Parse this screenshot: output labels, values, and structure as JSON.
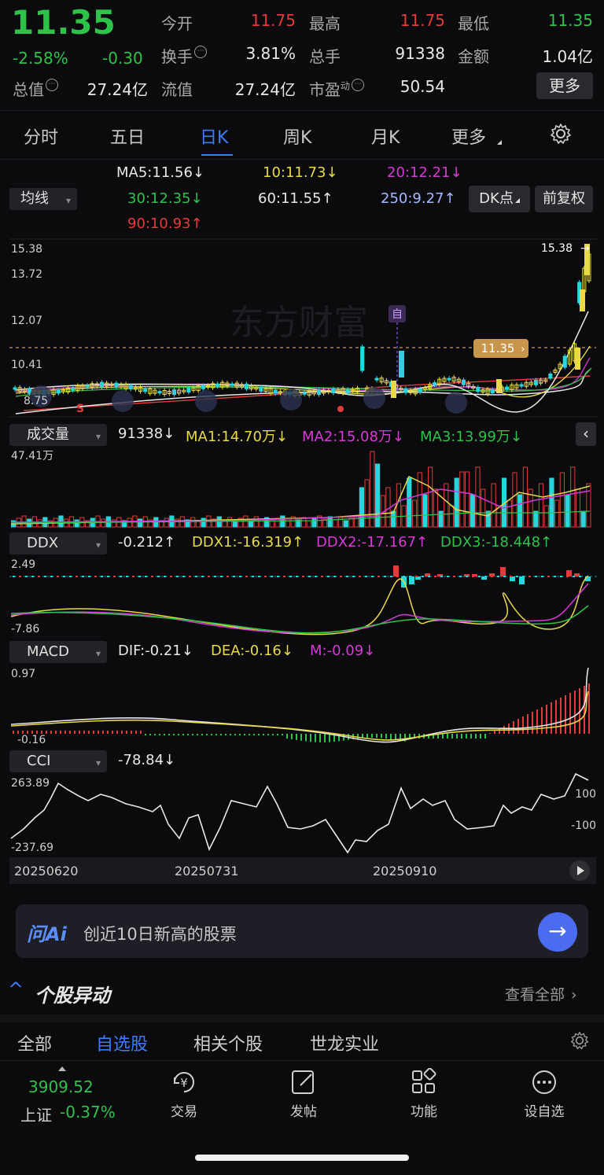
{
  "quote": {
    "price": "11.35",
    "pct": "-2.58%",
    "chg": "-0.30",
    "open_label": "今开",
    "open": "11.75",
    "high_label": "最高",
    "high": "11.75",
    "low_label": "最低",
    "low": "11.35",
    "turnover_label": "换手",
    "turnover": "3.81%",
    "volume_label": "总手",
    "volume": "91338",
    "amount_label": "金额",
    "amount": "1.04亿",
    "mktcap_label": "总值",
    "mktcap": "27.24亿",
    "float_label": "流值",
    "float": "27.24亿",
    "pe_label": "市盈",
    "pe_sup": "动",
    "pe": "50.54",
    "more_btn": "更多"
  },
  "tabs": [
    "分时",
    "五日",
    "日K",
    "周K",
    "月K",
    "更多"
  ],
  "active_tab": "日K",
  "ma_bar": {
    "selector": "均线",
    "ma5": "MA5:11.56↓",
    "ma10": "10:11.73↓",
    "ma20": "20:12.21↓",
    "ma30": "30:12.35↓",
    "ma60": "60:11.55↑",
    "ma250": "250:9.27↑",
    "ma90": "90:10.93↑",
    "dk_btn": "DK点",
    "adj_btn": "前复权"
  },
  "kline": {
    "y_labels": [
      "15.38",
      "13.72",
      "12.07",
      "10.41",
      "8.75"
    ],
    "y_left_extra": "8.75",
    "max_label": "15.38",
    "current_label": "11.35",
    "marker_zi": "自",
    "marker_s": "S",
    "watermark": "东方财富"
  },
  "volume": {
    "selector": "成交量",
    "value": "91338↓",
    "ma1": "MA1:14.70万↓",
    "ma2": "MA2:15.08万↓",
    "ma3": "MA3:13.99万↓",
    "axis_max": "47.41万"
  },
  "ddx": {
    "selector": "DDX",
    "value": "-0.212↑",
    "ddx1": "DDX1:-16.319↑",
    "ddx2": "DDX2:-17.167↑",
    "ddx3": "DDX3:-18.448↑",
    "axis_top": "2.49",
    "axis_bottom": "-7.86"
  },
  "macd": {
    "selector": "MACD",
    "dif": "DIF:-0.21↓",
    "dea": "DEA:-0.16↓",
    "m": "M:-0.09↓",
    "axis_top": "0.97",
    "axis_bottom": "-0.16"
  },
  "cci": {
    "selector": "CCI",
    "value": "-78.84↓",
    "axis_top": "263.89",
    "axis_bottom": "-237.69",
    "right_100": "100",
    "right_neg100": "-100"
  },
  "dates": [
    "20250620",
    "20250731",
    "20250910"
  ],
  "ai_bar": {
    "logo": "问Ai",
    "text": "创近10日新高的股票"
  },
  "anomaly": {
    "title": "个股异动",
    "view_all": "查看全部"
  },
  "bottom_tabs": [
    "全部",
    "自选股",
    "相关个股",
    "世龙实业"
  ],
  "active_bottom_tab": "自选股",
  "footer": {
    "index_value": "3909.52",
    "index_name": "上证",
    "index_pct": "-0.37%",
    "nav": [
      "交易",
      "发帖",
      "功能",
      "设自选"
    ]
  },
  "colors": {
    "up": "#e23b3b",
    "down": "#2fc24a",
    "accent": "#3d7bff",
    "bg": "#0b0b0d"
  }
}
